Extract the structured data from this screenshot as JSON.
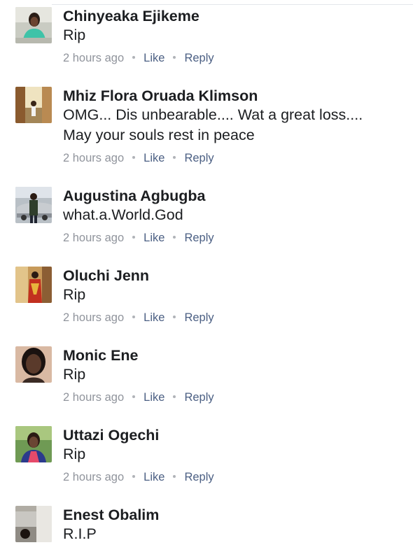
{
  "comments": [
    {
      "author": "Chinyeaka Ejikeme",
      "lines": [
        "Rip"
      ],
      "time": "2 hours ago",
      "like": "Like",
      "reply": "Reply",
      "avatar": "avatar-photo-woman-teal-top"
    },
    {
      "author": "Mhiz Flora Oruada Klimson",
      "lines": [
        "OMG... Dis unbearable.... Wat a great loss....",
        "May your souls rest in peace"
      ],
      "time": "2 hours ago",
      "like": "Like",
      "reply": "Reply",
      "avatar": "avatar-photo-hallway"
    },
    {
      "author": "Augustina Agbugba",
      "lines": [
        "what.a.World.God"
      ],
      "time": "2 hours ago",
      "like": "Like",
      "reply": "Reply",
      "avatar": "avatar-photo-man-with-car"
    },
    {
      "author": "Oluchi Jenn",
      "lines": [
        "Rip"
      ],
      "time": "2 hours ago",
      "like": "Like",
      "reply": "Reply",
      "avatar": "avatar-photo-woman-red-outfit"
    },
    {
      "author": "Monic Ene",
      "lines": [
        "Rip"
      ],
      "time": "2 hours ago",
      "like": "Like",
      "reply": "Reply",
      "avatar": "avatar-photo-woman-selfie"
    },
    {
      "author": "Uttazi Ogechi",
      "lines": [
        "Rip"
      ],
      "time": "2 hours ago",
      "like": "Like",
      "reply": "Reply",
      "avatar": "avatar-photo-person-outdoors"
    },
    {
      "author": "Enest Obalim",
      "lines": [
        "R.I.P"
      ],
      "time": "",
      "like": "",
      "reply": "",
      "avatar": "avatar-photo-room-interior"
    }
  ],
  "colors": {
    "author": "#1c1e21",
    "meta": "#90949c",
    "action": "#4b5f83"
  }
}
